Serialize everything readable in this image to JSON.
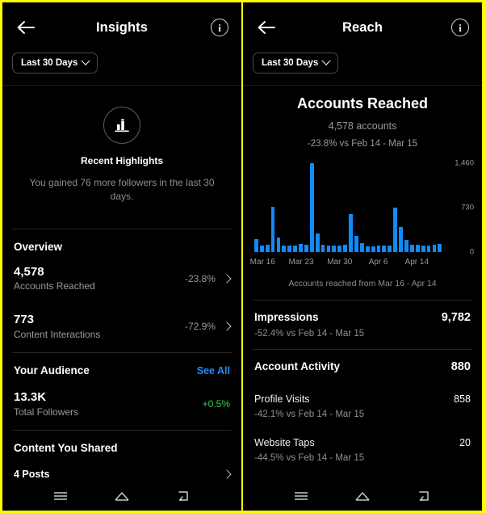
{
  "left": {
    "nav": {
      "back_icon": "back-arrow-icon",
      "title": "Insights",
      "info_icon": "info-circle-icon"
    },
    "date_filter": {
      "label": "Last 30 Days",
      "chevron_icon": "chevron-down-icon"
    },
    "highlights": {
      "icon": "bar-chart-icon",
      "title": "Recent Highlights",
      "subtitle": "You gained 76 more followers in the last 30 days."
    },
    "overview": {
      "title": "Overview",
      "rows": [
        {
          "value": "4,578",
          "label": "Accounts Reached",
          "delta": "-23.8%",
          "delta_positive": false,
          "chevron_icon": "chevron-right-icon"
        },
        {
          "value": "773",
          "label": "Content Interactions",
          "delta": "-72.9%",
          "delta_positive": false,
          "chevron_icon": "chevron-right-icon"
        }
      ]
    },
    "audience": {
      "title": "Your Audience",
      "see_all": "See All",
      "rows": [
        {
          "value": "13.3K",
          "label": "Total Followers",
          "delta": "+0.5%",
          "delta_positive": true
        }
      ]
    },
    "content_shared": {
      "title": "Content You Shared",
      "rows": [
        {
          "label": "4 Posts",
          "chevron_icon": "chevron-right-icon"
        }
      ]
    }
  },
  "right": {
    "nav": {
      "back_icon": "back-arrow-icon",
      "title": "Reach",
      "info_icon": "info-circle-icon"
    },
    "date_filter": {
      "label": "Last 30 Days",
      "chevron_icon": "chevron-down-icon"
    },
    "header": {
      "title": "Accounts Reached",
      "count": "4,578 accounts",
      "delta": "-23.8% vs Feb 14 - Mar 15"
    },
    "chart_caption": "Accounts reached from Mar 16 - Apr 14",
    "metrics": [
      {
        "name": "Impressions",
        "value": "9,782",
        "sub": "-52.4% vs Feb 14 - Mar 15",
        "style": "main"
      },
      {
        "name": "Account Activity",
        "value": "880",
        "sub": "",
        "style": "main"
      },
      {
        "name": "Profile Visits",
        "value": "858",
        "sub": "-42.1% vs Feb 14 - Mar 15",
        "style": "sub"
      },
      {
        "name": "Website Taps",
        "value": "20",
        "sub": "-44.5% vs Feb 14 - Mar 15",
        "style": "sub"
      }
    ]
  },
  "androidnav": {
    "recents_icon": "menu-hamburger-icon",
    "home_icon": "home-icon",
    "back_icon": "back-icon"
  },
  "colors": {
    "bar": "#0f8bfa",
    "link": "#1e8eff",
    "positive": "#3ad14b",
    "background": "#000000",
    "border": "#ffff00"
  },
  "chart_data": {
    "type": "bar",
    "title": "Accounts Reached",
    "xlabel": "",
    "ylabel": "",
    "ylim": [
      0,
      1460
    ],
    "yticks": [
      0,
      730,
      1460
    ],
    "ytick_labels": [
      "0",
      "730",
      "1,460"
    ],
    "grid": false,
    "legend": null,
    "bar_color": "#0f8bfa",
    "tick_label_positions": [
      1,
      8,
      15,
      22,
      29
    ],
    "tick_labels": [
      "Mar 16",
      "Mar 23",
      "Mar 30",
      "Apr 6",
      "Apr 14"
    ],
    "x": [
      "Mar 15",
      "Mar 16",
      "Mar 17",
      "Mar 18",
      "Mar 19",
      "Mar 20",
      "Mar 21",
      "Mar 22",
      "Mar 23",
      "Mar 24",
      "Mar 25",
      "Mar 26",
      "Mar 27",
      "Mar 28",
      "Mar 29",
      "Mar 30",
      "Mar 31",
      "Apr 1",
      "Apr 2",
      "Apr 3",
      "Apr 4",
      "Apr 5",
      "Apr 6",
      "Apr 7",
      "Apr 8",
      "Apr 9",
      "Apr 10",
      "Apr 11",
      "Apr 12",
      "Apr 13",
      "Apr 14"
    ],
    "values": [
      210,
      105,
      120,
      740,
      235,
      110,
      105,
      100,
      130,
      115,
      1455,
      310,
      125,
      105,
      100,
      110,
      125,
      620,
      260,
      140,
      90,
      95,
      100,
      105,
      110,
      725,
      415,
      200,
      120,
      115,
      110,
      105,
      120,
      130
    ],
    "caption": "Accounts reached from Mar 16 - Apr 14"
  }
}
